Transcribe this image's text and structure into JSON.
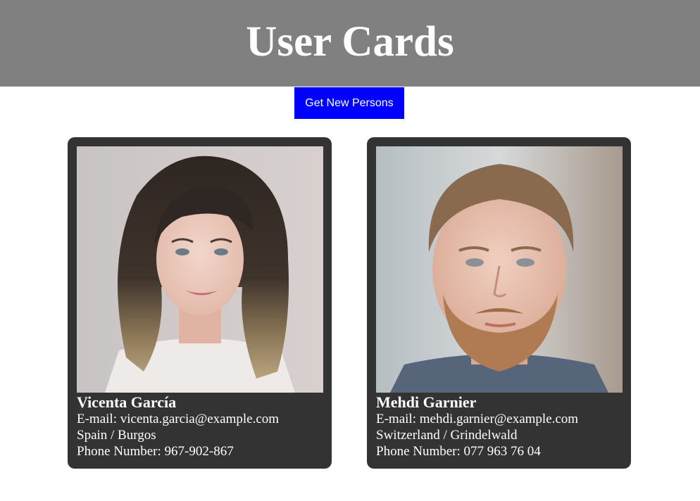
{
  "header": {
    "title": "User Cards"
  },
  "actions": {
    "get_new_label": "Get New Persons"
  },
  "colors": {
    "header_bg": "#808080",
    "button_bg": "#0000ff",
    "card_bg": "#333333",
    "text": "#ffffff"
  },
  "cards": [
    {
      "name": "Vicenta García",
      "email": "E-mail: vicenta.garcia@example.com",
      "location": "Spain / Burgos",
      "phone": "Phone Number: 967-902-867",
      "photo": "portrait-photo-woman"
    },
    {
      "name": "Mehdi Garnier",
      "email": "E-mail: mehdi.garnier@example.com",
      "location": "Switzerland / Grindelwald",
      "phone": "Phone Number: 077 963 76 04",
      "photo": "portrait-photo-man"
    }
  ]
}
